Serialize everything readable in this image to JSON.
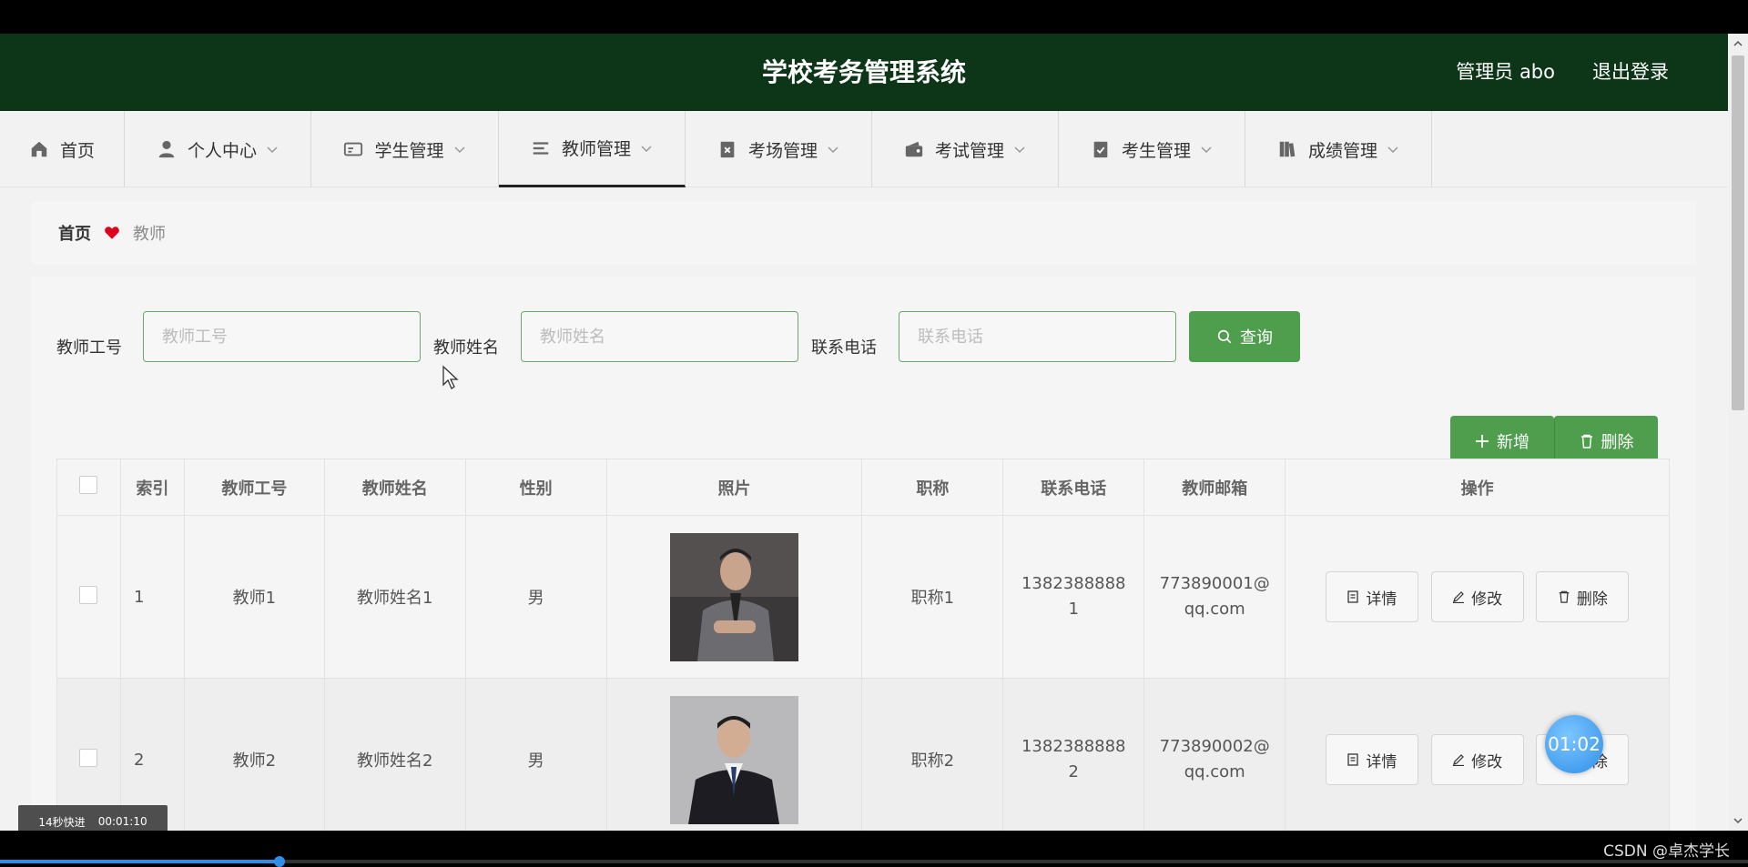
{
  "header": {
    "title": "学校考务管理系统",
    "user": "管理员 abo",
    "logout": "退出登录"
  },
  "nav": [
    {
      "label": "首页",
      "icon": "home-icon"
    },
    {
      "label": "个人中心",
      "icon": "user-icon"
    },
    {
      "label": "学生管理",
      "icon": "id-card-icon"
    },
    {
      "label": "教师管理",
      "icon": "menu-icon",
      "active": true
    },
    {
      "label": "考场管理",
      "icon": "clipboard-x-icon"
    },
    {
      "label": "考试管理",
      "icon": "wallet-icon"
    },
    {
      "label": "考生管理",
      "icon": "clipboard-check-icon"
    },
    {
      "label": "成绩管理",
      "icon": "books-icon"
    }
  ],
  "breadcrumb": {
    "home": "首页",
    "current": "教师"
  },
  "search": {
    "fields": [
      {
        "label": "教师工号",
        "placeholder": "教师工号",
        "value": ""
      },
      {
        "label": "教师姓名",
        "placeholder": "教师姓名",
        "value": ""
      },
      {
        "label": "联系电话",
        "placeholder": "联系电话",
        "value": ""
      }
    ],
    "query_label": "查询"
  },
  "actions": {
    "add_label": "新增",
    "delete_label": "删除"
  },
  "table": {
    "headers": [
      "索引",
      "教师工号",
      "教师姓名",
      "性别",
      "照片",
      "职称",
      "联系电话",
      "教师邮箱",
      "操作"
    ],
    "rows": [
      {
        "index": "1",
        "id": "教师1",
        "name": "教师姓名1",
        "gender": "男",
        "title": "职称1",
        "phone": "13823888881",
        "email": "773890001@qq.com"
      },
      {
        "index": "2",
        "id": "教师2",
        "name": "教师姓名2",
        "gender": "男",
        "title": "职称2",
        "phone": "13823888882",
        "email": "773890002@qq.com"
      }
    ],
    "op_labels": {
      "detail": "详情",
      "edit": "修改",
      "delete": "删除"
    }
  },
  "player": {
    "speed_label": "14秒快进",
    "time": "00:01:10",
    "bubble_time": "01:02",
    "progress_fraction": 0.16
  },
  "watermark": "CSDN @卓杰学长",
  "colors": {
    "header_bg": "#0c3617",
    "accent_green": "#4e9e4e",
    "heart": "#e0001b"
  }
}
